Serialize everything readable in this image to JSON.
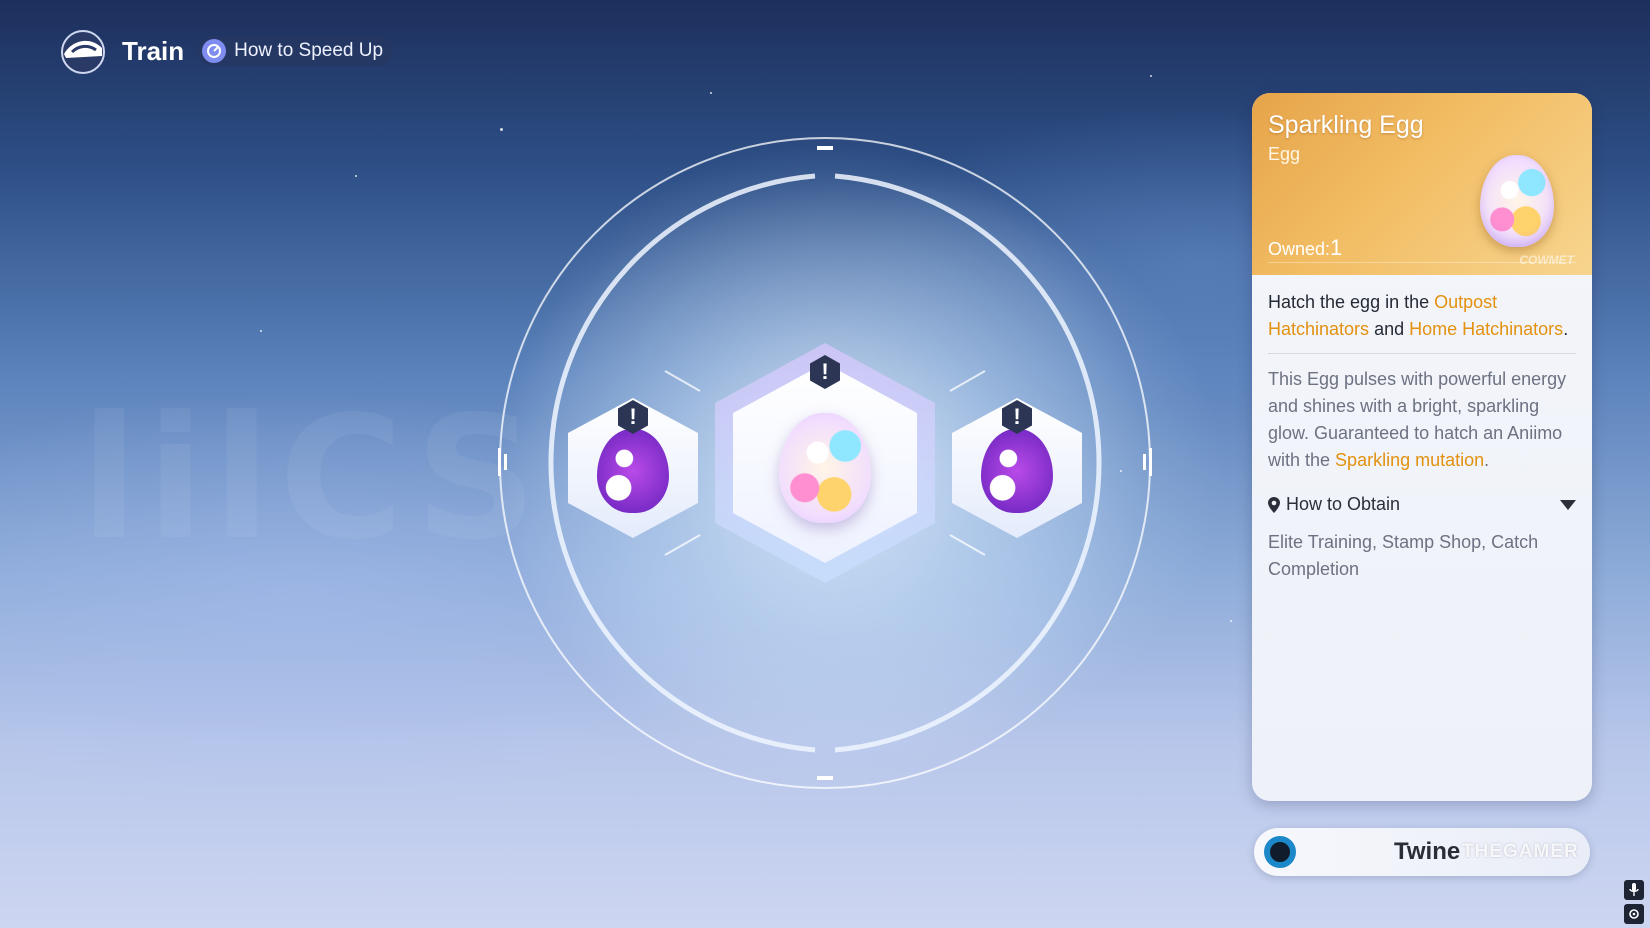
{
  "header": {
    "title": "Train",
    "speed_up_label": "How to Speed Up"
  },
  "background": {
    "faint_text": "lilCS"
  },
  "eggs": [
    {
      "name": "left-egg",
      "alert": "!"
    },
    {
      "name": "center-egg",
      "alert": "!",
      "selected": true
    },
    {
      "name": "right-egg",
      "alert": "!"
    }
  ],
  "detail_panel": {
    "item_name": "Sparkling Egg",
    "item_type": "Egg",
    "owned_label": "Owned:",
    "owned_count": "1",
    "brand_deco": "COWMET",
    "description": {
      "part1": "Hatch the egg in the ",
      "link1": "Outpost Hatchinators",
      "part2": " and ",
      "link2": "Home Hatchinators",
      "part3": "."
    },
    "flavor": {
      "text": "This Egg pulses with powerful energy and shines with a bright, sparkling glow. Guaranteed to hatch an Aniimo with the ",
      "highlight": "Sparkling mutation",
      "end": "."
    },
    "obtain_label": "How to Obtain",
    "obtain_text": "Elite Training, Stamp Shop, Catch Completion"
  },
  "name_bar": {
    "name": "Twine",
    "watermark": "THEGAMER"
  },
  "colors": {
    "accent_orange": "#e3910f",
    "panel_header": "#f2bd64",
    "ring_glow": "#dcebff"
  }
}
